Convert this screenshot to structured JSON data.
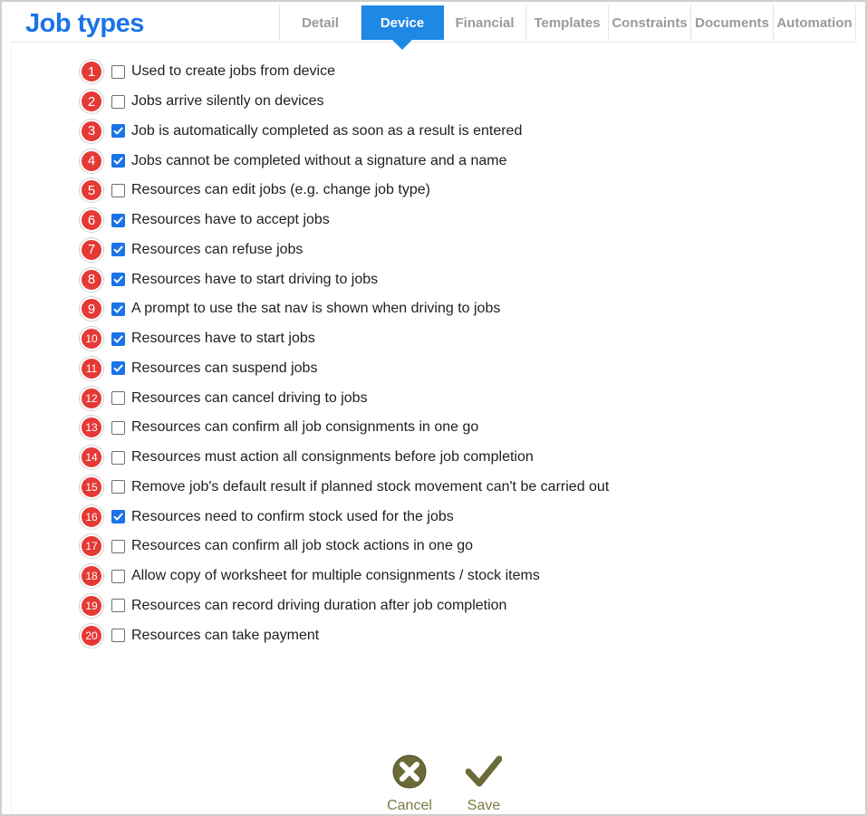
{
  "header": {
    "title": "Job types",
    "tabs": [
      {
        "label": "Detail",
        "active": false
      },
      {
        "label": "Device",
        "active": true
      },
      {
        "label": "Financial",
        "active": false
      },
      {
        "label": "Templates",
        "active": false
      },
      {
        "label": "Constraints",
        "active": false
      },
      {
        "label": "Documents",
        "active": false
      },
      {
        "label": "Automation",
        "active": false
      }
    ]
  },
  "options": [
    {
      "num": "1",
      "label": "Used to create jobs from device",
      "checked": false
    },
    {
      "num": "2",
      "label": "Jobs arrive silently on devices",
      "checked": false
    },
    {
      "num": "3",
      "label": "Job is automatically completed as soon as a result is entered",
      "checked": true
    },
    {
      "num": "4",
      "label": "Jobs cannot be completed without a signature and a name",
      "checked": true
    },
    {
      "num": "5",
      "label": "Resources can edit jobs (e.g. change job type)",
      "checked": false
    },
    {
      "num": "6",
      "label": "Resources have to accept jobs",
      "checked": true
    },
    {
      "num": "7",
      "label": "Resources can refuse jobs",
      "checked": true
    },
    {
      "num": "8",
      "label": "Resources have to start driving to jobs",
      "checked": true
    },
    {
      "num": "9",
      "label": "A prompt to use the sat nav is shown when driving to jobs",
      "checked": true
    },
    {
      "num": "10",
      "label": "Resources have to start jobs",
      "checked": true
    },
    {
      "num": "11",
      "label": "Resources can suspend jobs",
      "checked": true
    },
    {
      "num": "12",
      "label": "Resources can cancel driving to jobs",
      "checked": false
    },
    {
      "num": "13",
      "label": "Resources can confirm all job consignments in one go",
      "checked": false
    },
    {
      "num": "14",
      "label": "Resources must action all consignments before job completion",
      "checked": false
    },
    {
      "num": "15",
      "label": "Remove job's default result if planned stock movement can't be carried out",
      "checked": false
    },
    {
      "num": "16",
      "label": "Resources need to confirm stock used for the jobs",
      "checked": true
    },
    {
      "num": "17",
      "label": "Resources can confirm all job stock actions in one go",
      "checked": false
    },
    {
      "num": "18",
      "label": "Allow copy of worksheet for multiple consignments / stock items",
      "checked": false
    },
    {
      "num": "19",
      "label": "Resources can record driving duration after job completion",
      "checked": false
    },
    {
      "num": "20",
      "label": "Resources can take payment",
      "checked": false
    }
  ],
  "actions": {
    "cancel_label": "Cancel",
    "save_label": "Save",
    "cancel_icon": "close-circle-icon",
    "save_icon": "checkmark-icon"
  },
  "colors": {
    "accent": "#1e88e5",
    "badge": "#e53935",
    "action_text": "#7a7a42",
    "action_icon": "#6b6b3a"
  }
}
